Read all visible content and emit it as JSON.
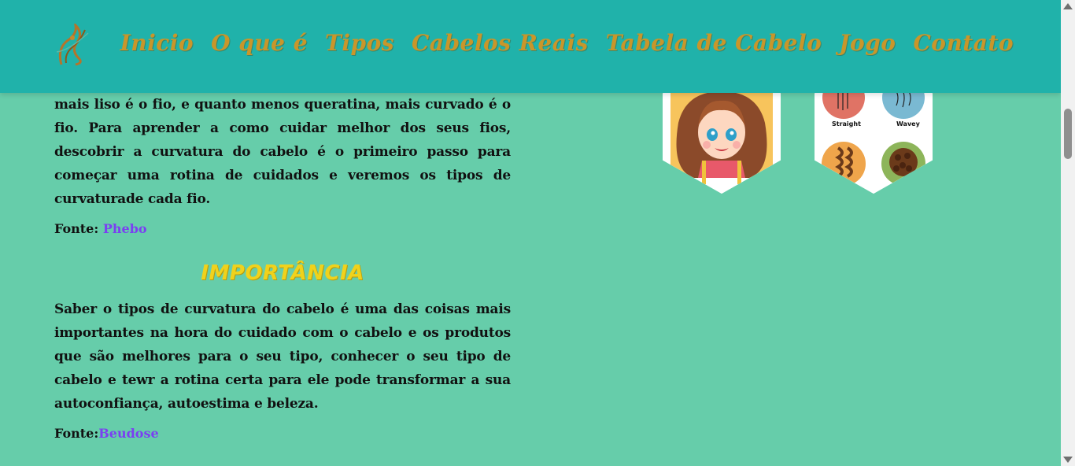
{
  "nav": {
    "items": [
      "Inicio",
      "O que é",
      "Tipos",
      "Cabelos Reais",
      "Tabela de Cabelo",
      "Jogo",
      "Contato"
    ]
  },
  "content": {
    "paragraph1": "do cabelo. Quanto mais queratina há na estrutura capilar, mais liso é o fio, e quanto menos queratina, mais curvado é o fio. Para aprender a como cuidar melhor dos seus fios, descobrir a curvatura do cabelo é o primeiro passo para começar uma rotina de cuidados e veremos os tipos de curvaturade cada fio.",
    "fonte1_label": "Fonte: ",
    "fonte1_link": "Phebo",
    "section_title": "IMPORTÂNCIA",
    "paragraph2": "Saber o tipos de curvatura do cabelo é uma das coisas mais importantes na hora do cuidado com o cabelo e os produtos que são melhores para o seu tipo, conhecer o seu tipo de cabelo e tewr a rotina certa para ele pode transformar a sua autoconfiança, autoestima e beleza.",
    "fonte2_label": "Fonte:",
    "fonte2_link": "Beudose"
  },
  "hex_images": {
    "hair_labels": [
      "Straight",
      "Wavey"
    ]
  }
}
